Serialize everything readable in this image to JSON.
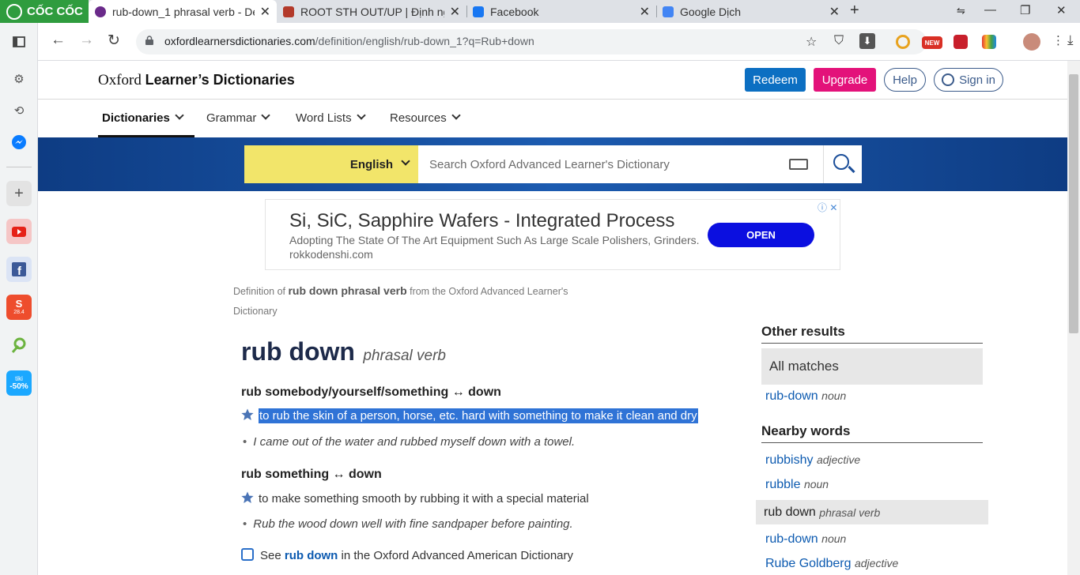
{
  "browser": {
    "brand": "CỐC CỐC",
    "tabs": [
      {
        "title": "rub-down_1 phrasal verb - De",
        "active": true,
        "favicon_color": "#6a2a8a"
      },
      {
        "title": "ROOT STH OUT/UP | Định ngh",
        "active": false,
        "favicon_color": "#b33a2a"
      },
      {
        "title": "Facebook",
        "active": false,
        "favicon_color": "#1877f2"
      },
      {
        "title": "Google Dịch",
        "active": false,
        "favicon_color": "#4285f4"
      }
    ],
    "url": {
      "host": "oxfordlearnersdictionaries.com",
      "path": "/definition/english/rub-down_1?q=Rub+down"
    }
  },
  "sidebar": {
    "icons": [
      "sidebar-toggle-icon",
      "settings-icon",
      "history-icon",
      "messenger-icon",
      "add-icon",
      "youtube-icon",
      "facebook-icon",
      "shopee-icon",
      "leaf-icon",
      "tiki-icon"
    ],
    "shopee_badge": "28.4",
    "tiki_badge_name": "tiki",
    "tiki_badge_discount": "-50%"
  },
  "site": {
    "logo_plain": "Oxford ",
    "logo_bold": "Learner’s Dictionaries",
    "buttons": {
      "redeem": "Redeem",
      "upgrade": "Upgrade",
      "help": "Help",
      "signin": "Sign in"
    },
    "menu": [
      "Dictionaries",
      "Grammar",
      "Word Lists",
      "Resources"
    ],
    "search": {
      "language": "English",
      "placeholder": "Search Oxford Advanced Learner's Dictionary"
    }
  },
  "ad": {
    "title": "Si, SiC, Sapphire Wafers - Integrated Process",
    "desc": "Adopting The State Of The Art Equipment Such As Large Scale Polishers, Grinders.",
    "url": "rokkodenshi.com",
    "cta": "OPEN"
  },
  "entry": {
    "source_prefix": "Definition of ",
    "source_term": "rub down phrasal verb",
    "source_suffix": " from the Oxford Advanced Learner's Dictionary",
    "headword": "rub down",
    "pos": "phrasal verb",
    "senses": [
      {
        "pattern": "rub somebody/yourself/something ↔ down",
        "definition": "to rub the skin of a person, horse, etc. hard with something to make it clean and dry",
        "example": "I came out of the water and rubbed myself down with a towel."
      },
      {
        "pattern": "rub something ↔ down",
        "definition": "to make something smooth by rubbing it with a special material",
        "example": "Rub the wood down well with fine sandpaper before painting."
      }
    ],
    "see_also": {
      "prefix": "See ",
      "term": "rub down",
      "suffix": " in the Oxford Advanced American Dictionary"
    }
  },
  "other_results": {
    "title": "Other results",
    "all_matches": "All matches",
    "items": [
      {
        "word": "rub-down",
        "pos": "noun"
      }
    ]
  },
  "nearby_words": {
    "title": "Nearby words",
    "items": [
      {
        "word": "rubbishy",
        "pos": "adjective",
        "current": false
      },
      {
        "word": "rubble",
        "pos": "noun",
        "current": false
      },
      {
        "word": "rub down",
        "pos": "phrasal verb",
        "current": true
      },
      {
        "word": "rub-down",
        "pos": "noun",
        "current": false
      },
      {
        "word": "Rube Goldberg",
        "pos": "adjective",
        "current": false
      }
    ]
  },
  "colors": {
    "brand_green": "#2f9c3e",
    "oxford_blue": "#0e3c83",
    "redeem": "#0c6fc2",
    "upgrade": "#e3127a",
    "highlight": "#2f73d6",
    "link": "#0c5ab0"
  }
}
